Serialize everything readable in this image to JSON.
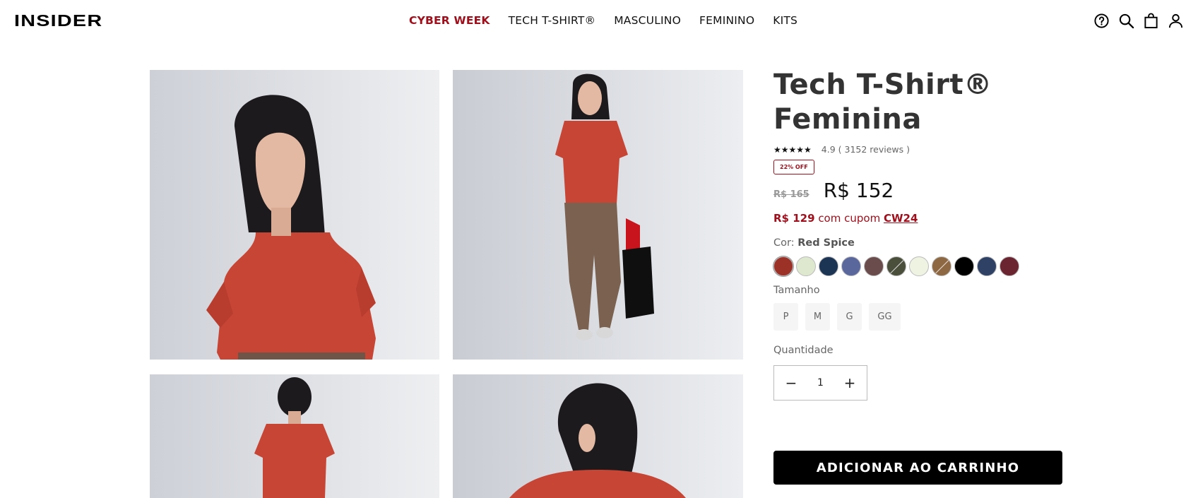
{
  "header": {
    "logo": "INSIDER",
    "nav": [
      {
        "label": "CYBER WEEK",
        "promo": true
      },
      {
        "label": "TECH T-SHIRT®"
      },
      {
        "label": "MASCULINO"
      },
      {
        "label": "FEMININO"
      },
      {
        "label": "KITS"
      }
    ],
    "icons": [
      "help-icon",
      "search-icon",
      "bag-icon",
      "user-icon"
    ]
  },
  "product": {
    "title_line1": "Tech T-Shirt®",
    "title_line2": "Feminina",
    "stars": "★★★★★",
    "rating_text": "4.9 ( 3152 reviews )",
    "badge": "22% OFF",
    "old_price": "R$ 165",
    "price": "R$ 152",
    "coupon_price": "R$ 129",
    "coupon_text": "com cupom",
    "coupon_code": "CW24",
    "color_label": "Cor:",
    "color_value": "Red Spice",
    "swatches": [
      "#9c3128",
      "#dde8cf",
      "#1d3554",
      "#5a679d",
      "#6b4c4c",
      "#4a4f3c",
      "#eef3e2",
      "#8e6843",
      "#000000",
      "#2f4266",
      "#6a2530"
    ],
    "size_label": "Tamanho",
    "sizes": [
      "P",
      "M",
      "G",
      "GG"
    ],
    "qty_label": "Quantidade",
    "qty_value": "1",
    "qty_minus": "−",
    "qty_plus": "+",
    "add_to_cart": "ADICIONAR AO CARRINHO"
  },
  "colors": {
    "accent": "#a0101c",
    "shirt": "#c74535",
    "button": "#000000"
  }
}
